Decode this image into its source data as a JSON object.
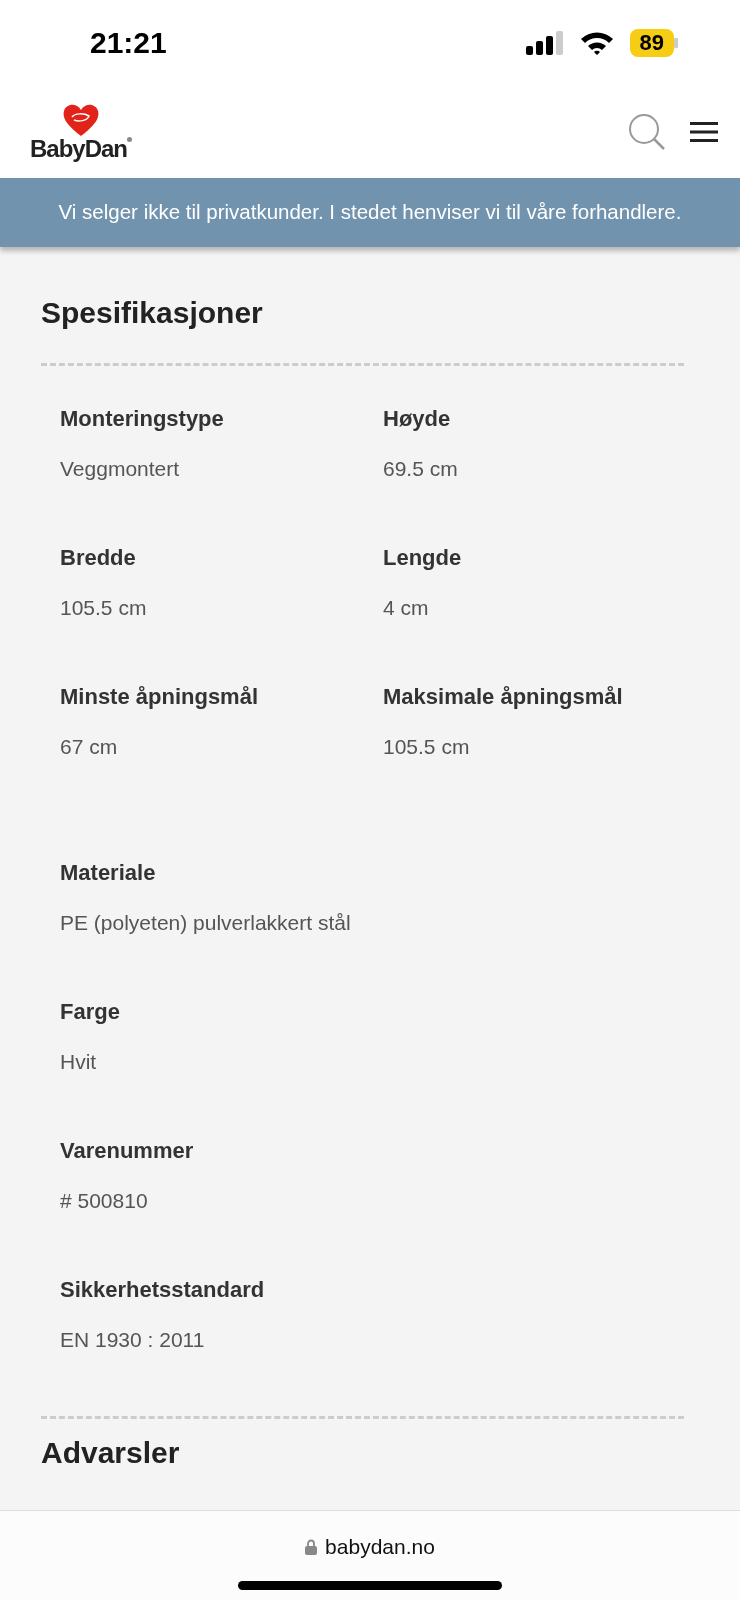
{
  "status_bar": {
    "time": "21:21",
    "battery": "89"
  },
  "header": {
    "logo_text": "BabyDan"
  },
  "banner": {
    "text": "Vi selger ikke til privatkunder. I stedet henviser vi til våre forhandlere."
  },
  "specifications": {
    "title": "Spesifikasjoner",
    "grid": [
      {
        "label": "Monteringstype",
        "value": "Veggmontert"
      },
      {
        "label": "Høyde",
        "value": "69.5 cm"
      },
      {
        "label": "Bredde",
        "value": "105.5 cm"
      },
      {
        "label": "Lengde",
        "value": "4 cm"
      },
      {
        "label": "Minste åpningsmål",
        "value": "67 cm"
      },
      {
        "label": "Maksimale åpningsmål",
        "value": "105.5 cm"
      }
    ],
    "list": [
      {
        "label": "Materiale",
        "value": "PE (polyeten) pulverlakkert stål"
      },
      {
        "label": "Farge",
        "value": "Hvit"
      },
      {
        "label": "Varenummer",
        "value": "# 500810"
      },
      {
        "label": "Sikkerhetsstandard",
        "value": "EN 1930 : 2011"
      }
    ]
  },
  "next_section": {
    "title": "Advarsler"
  },
  "browser_bar": {
    "url": "babydan.no"
  }
}
